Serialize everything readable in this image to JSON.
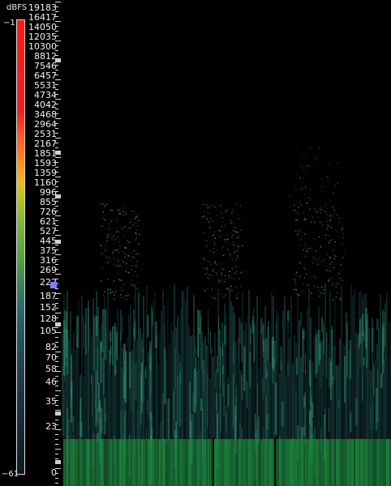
{
  "scale": {
    "unit_label": "dBFS",
    "top_value": "−1",
    "bottom_value": "−61"
  },
  "frequency_axis": {
    "labels": [
      "19183",
      "16417",
      "14050",
      "12035",
      "10300",
      "8812",
      "7546",
      "6457",
      "5531",
      "4734",
      "4042",
      "3468",
      "2964",
      "2531",
      "2167",
      "1851",
      "1593",
      "1359",
      "1160",
      "996",
      "855",
      "726",
      "621",
      "527",
      "445",
      "375",
      "316",
      "269",
      "222",
      "187",
      "152",
      "128",
      "105",
      "82",
      "70",
      "58",
      "46",
      "35",
      "23",
      "0"
    ]
  },
  "colors": {
    "background": "#000000",
    "spectrum_low": "#1a4a4a",
    "spectrum_mid": "#2f8a6a",
    "spectrum_band": "#1e8a3a",
    "highlight_marker": "#8080ff"
  }
}
